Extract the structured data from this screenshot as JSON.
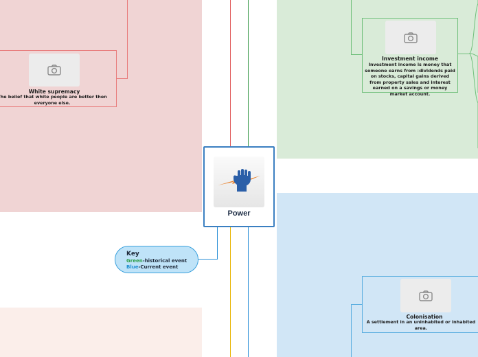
{
  "central": {
    "label": "Power",
    "logo_icon": "raised-fist-lightning-icon",
    "border_color": "#3a7fc1"
  },
  "key": {
    "title": "Key",
    "green_word": "Green",
    "green_rest": "-historical event",
    "blue_word": "Blue",
    "blue_rest": "-Current event",
    "green_color": "#2e9e4a",
    "blue_color": "#1f8fd0"
  },
  "topics": [
    {
      "id": "white-supremacy",
      "title": "White supremacy",
      "description": "The belief that white people are better then everyone else.",
      "image_icon": "camera-icon",
      "color": "#e87a7a"
    },
    {
      "id": "investment-income",
      "title": "Investment income",
      "description": "Investment income is money that someone earns from :dividends paid on stocks, capital gains derived from property sales and interest earned on a savings or money market account.",
      "image_icon": "camera-icon",
      "color": "#6fbf7a"
    },
    {
      "id": "colonisation",
      "title": "Colonisation",
      "description": "A settlement in an uninhabited or inhabited area.",
      "image_icon": "camera-icon",
      "color": "#5aaee0"
    }
  ],
  "regions": {
    "red_bg": "#f0d4d4",
    "green_bg": "#d9ebd8",
    "blue_bg": "#d1e6f6",
    "peach_bg": "#fbeeea"
  }
}
